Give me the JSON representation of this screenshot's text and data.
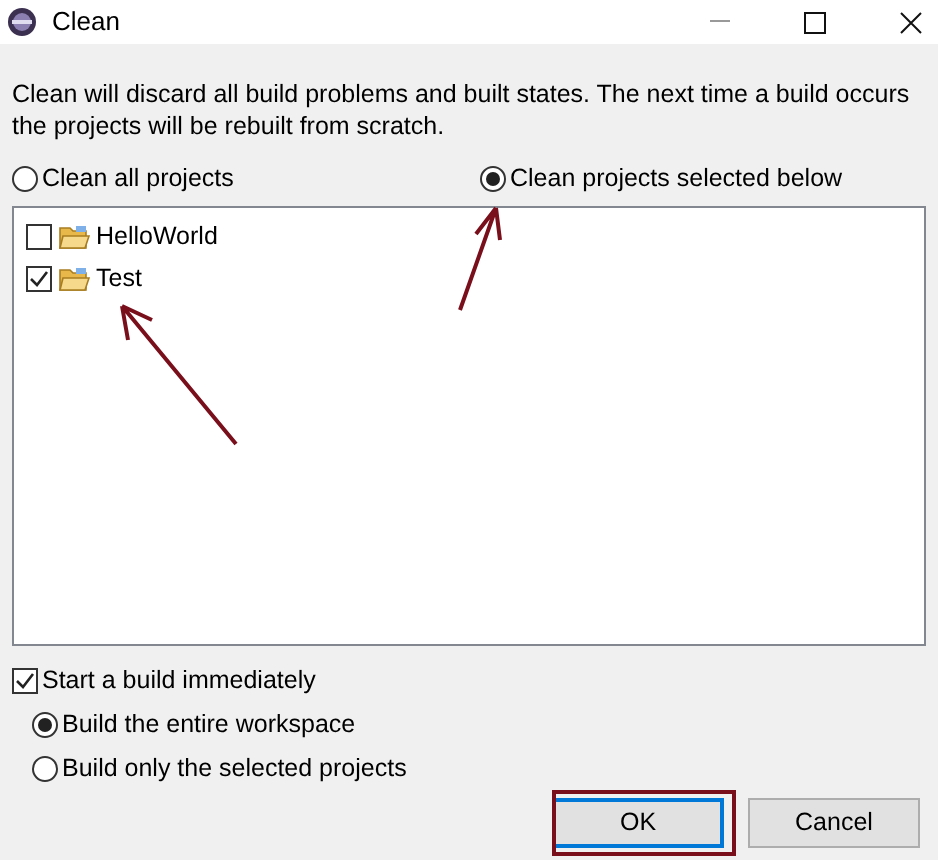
{
  "window": {
    "title": "Clean"
  },
  "description": "Clean will discard all build problems and built states.  The next time a build occurs the projects will be rebuilt from scratch.",
  "scope_options": [
    {
      "label": "Clean all projects",
      "selected": false
    },
    {
      "label": "Clean projects selected below",
      "selected": true
    }
  ],
  "projects": [
    {
      "name": "HelloWorld",
      "checked": false
    },
    {
      "name": "Test",
      "checked": true
    }
  ],
  "start_build": {
    "label": "Start a build immediately",
    "checked": true
  },
  "build_options": [
    {
      "label": "Build the entire workspace",
      "selected": true
    },
    {
      "label": "Build only the selected projects",
      "selected": false
    }
  ],
  "buttons": [
    {
      "label": "OK",
      "kind": "default"
    },
    {
      "label": "Cancel",
      "kind": "normal"
    }
  ]
}
